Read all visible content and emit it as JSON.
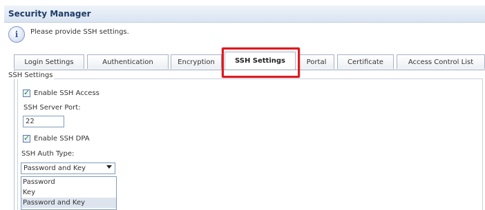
{
  "window": {
    "title": "Security Manager"
  },
  "info": {
    "message": "Please provide SSH settings.",
    "icon": "info-icon"
  },
  "tabs": [
    {
      "label": "Login Settings"
    },
    {
      "label": "Authentication"
    },
    {
      "label": "Encryption"
    },
    {
      "label": "SSH Settings",
      "active": true
    },
    {
      "label": "Portal"
    },
    {
      "label": "Certificate"
    },
    {
      "label": "Access Control List"
    }
  ],
  "ssh": {
    "section_title": "SSH Settings",
    "enable_ssh_access": {
      "label": "Enable SSH Access",
      "checked": true
    },
    "server_port": {
      "label": "SSH Server Port:",
      "value": "22"
    },
    "enable_ssh_dpa": {
      "label": "Enable SSH DPA",
      "checked": true
    },
    "auth_type": {
      "label": "SSH Auth Type:",
      "selected": "Password and Key",
      "options": [
        "Password",
        "Key",
        "Password and Key"
      ]
    }
  },
  "colors": {
    "highlight": "#e0181e",
    "title_text": "#1f3d66",
    "check_mark": "#2a8a2a"
  }
}
